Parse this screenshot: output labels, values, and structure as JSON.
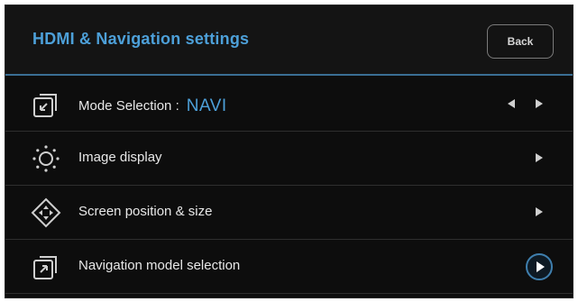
{
  "header": {
    "title": "HDMI & Navigation settings",
    "back_label": "Back"
  },
  "menu": {
    "items": [
      {
        "label": "Mode Selection :",
        "value": "NAVI",
        "icon": "mode-selection-icon"
      },
      {
        "label": "Image display",
        "icon": "brightness-icon"
      },
      {
        "label": "Screen position & size",
        "icon": "move-arrows-icon"
      },
      {
        "label": "Navigation model selection",
        "icon": "navigation-model-icon"
      }
    ]
  },
  "colors": {
    "accent": "#4da0d9",
    "background": "#0d0d0d",
    "text": "#e8e8e8"
  }
}
